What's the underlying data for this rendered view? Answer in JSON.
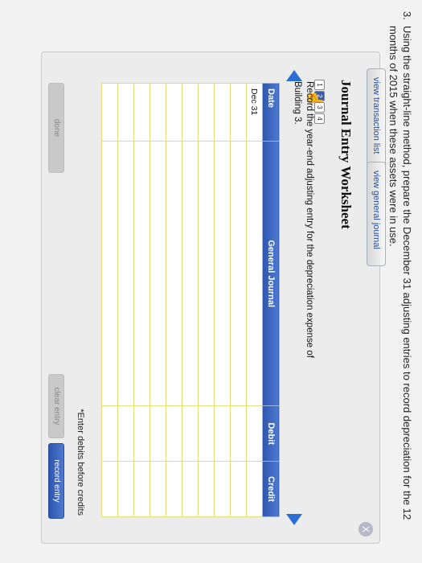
{
  "question": {
    "number": "3.",
    "text": "Using the straight-line method, prepare the December 31 adjusting entries to record depreciation for the 12 months of 2015 when these assets were in use."
  },
  "tabs": {
    "transaction_list": "view transaction list",
    "general_journal": "view general journal"
  },
  "worksheet": {
    "title": "Journal Entry Worksheet",
    "close": "X",
    "steps": [
      "1",
      "2",
      "3",
      "4"
    ],
    "active_step": 2,
    "instruction": "Record the year-end adjusting entry for the depreciation expense of Building 3."
  },
  "table": {
    "headers": {
      "date": "Date",
      "journal": "General Journal",
      "debit": "Debit",
      "credit": "Credit"
    },
    "rows": [
      {
        "date": "Dec 31",
        "journal": "",
        "debit": "",
        "credit": ""
      },
      {
        "date": "",
        "journal": "",
        "debit": "",
        "credit": ""
      },
      {
        "date": "",
        "journal": "",
        "debit": "",
        "credit": ""
      },
      {
        "date": "",
        "journal": "",
        "debit": "",
        "credit": ""
      },
      {
        "date": "",
        "journal": "",
        "debit": "",
        "credit": ""
      },
      {
        "date": "",
        "journal": "",
        "debit": "",
        "credit": ""
      },
      {
        "date": "",
        "journal": "",
        "debit": "",
        "credit": ""
      },
      {
        "date": "",
        "journal": "",
        "debit": "",
        "credit": ""
      },
      {
        "date": "",
        "journal": "",
        "debit": "",
        "credit": ""
      },
      {
        "date": "",
        "journal": "",
        "debit": "",
        "credit": ""
      }
    ]
  },
  "note": "*Enter debits before credits",
  "buttons": {
    "done": "done",
    "clear": "clear entry",
    "record": "record entry"
  }
}
